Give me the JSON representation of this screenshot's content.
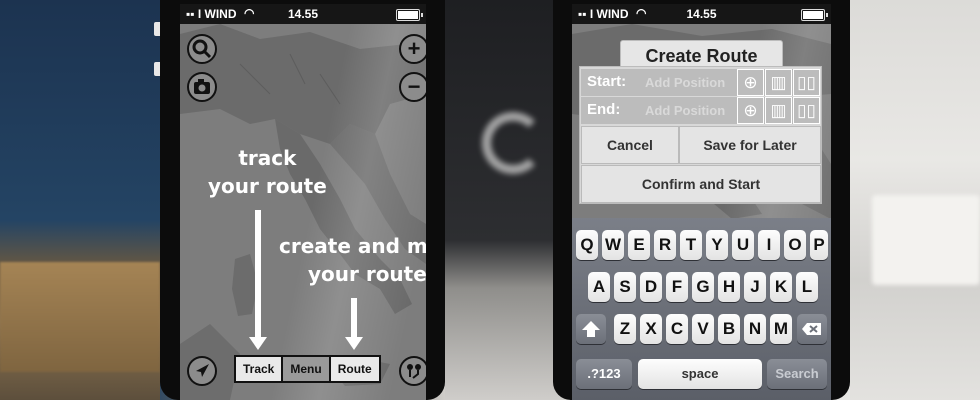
{
  "statusbar": {
    "carrier": "▪▪ I WIND",
    "time": "14.55"
  },
  "left_screen": {
    "annotation_track": [
      "track",
      "your route"
    ],
    "annotation_route": [
      "create and mod",
      "your route"
    ],
    "bottom_bar": {
      "track_label": "Track",
      "menu_label": "Menu",
      "route_label": "Route"
    },
    "icons": {
      "search": "search-icon",
      "camera": "camera-icon",
      "zoom_in": "plus-icon",
      "zoom_out": "minus-icon",
      "locate": "location-arrow-icon",
      "route_pins": "route-pins-icon"
    }
  },
  "right_screen": {
    "title": "Create Route",
    "start_label": "Start:",
    "start_placeholder": "Add Position",
    "end_label": "End:",
    "end_placeholder": "Add Position",
    "cancel_label": "Cancel",
    "save_label": "Save for Later",
    "confirm_label": "Confirm and Start",
    "row_icons": [
      "crosshair-icon",
      "map-icon",
      "book-icon"
    ]
  },
  "keyboard": {
    "row1": [
      "Q",
      "W",
      "E",
      "R",
      "T",
      "Y",
      "U",
      "I",
      "O",
      "P"
    ],
    "row2": [
      "A",
      "S",
      "D",
      "F",
      "G",
      "H",
      "J",
      "K",
      "L"
    ],
    "row3": [
      "Z",
      "X",
      "C",
      "V",
      "B",
      "N",
      "M"
    ],
    "numbers_label": ".?123",
    "space_label": "space",
    "search_label": "Search"
  },
  "colors": {
    "map_sea": "#7d7d7d",
    "map_land": "#6a6a6a",
    "annotation": "#ffffff"
  }
}
